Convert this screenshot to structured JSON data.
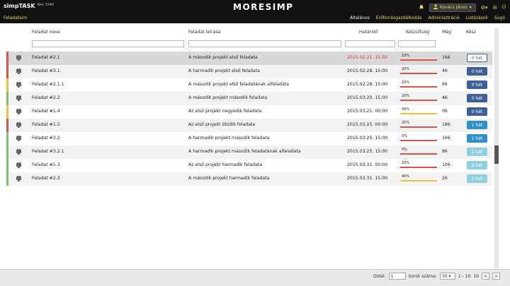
{
  "app": {
    "title": "simpTASK",
    "rev": "Rev 1046",
    "logo": "MORESIMP"
  },
  "topright": {
    "bell_icon": "bell-icon",
    "user": "Kovács János",
    "gear_icon": "gear-icon",
    "mail_icon": "mail-icon",
    "logout_icon": "logout-icon"
  },
  "nav": {
    "left": "Feladataim",
    "items": [
      {
        "label": "Általános",
        "active": true
      },
      {
        "label": "Erőforrásgazdálkodás",
        "active": false
      },
      {
        "label": "Adminisztráció",
        "active": false
      },
      {
        "label": "Listázások",
        "active": false
      },
      {
        "label": "Súgó",
        "active": false
      }
    ]
  },
  "columns": {
    "name": "Feladat neve",
    "desc": "Feladat leírása",
    "deadline": "Határidő",
    "progress": "Készültség",
    "remaining": "Még",
    "done": "Kész"
  },
  "rows": [
    {
      "name": "Feladat #2.1",
      "desc": "A második projekt első feladata",
      "date": "2015.02.21. 15:00",
      "overdue": true,
      "progress": "10%",
      "progress_val": 10,
      "remaining": "166",
      "done": "0 hét",
      "stripe": "#d9534f",
      "selected": true
    },
    {
      "name": "Feladat #3.1",
      "desc": "A harmadik projekt első feladata",
      "date": "2015.02.28. 15:00",
      "overdue": false,
      "progress": "20%",
      "progress_val": 20,
      "remaining": "46",
      "done": "0 hét",
      "stripe": "#d9534f"
    },
    {
      "name": "Feladat #2.1.1",
      "desc": "A második projekt első feladatának alfeladata",
      "date": "2015.02.28. 15:00",
      "overdue": false,
      "progress": "10%",
      "progress_val": 10,
      "remaining": "66",
      "done": "0 hét",
      "stripe": "#f0c13a"
    },
    {
      "name": "Feladat #2.2",
      "desc": "A második projekt második feladata",
      "date": "2015.03.20. 15:00",
      "overdue": false,
      "progress": "20%",
      "progress_val": 20,
      "remaining": "46",
      "done": "0 hét",
      "stripe": "#7cc070"
    },
    {
      "name": "Feladat #1.4",
      "desc": "Az első projekt negyedik feladata",
      "date": "2015.03.21. 00:00",
      "overdue": false,
      "progress": "50%",
      "progress_val": 50,
      "remaining": "06",
      "done": "0 hét",
      "stripe": "#f0c13a"
    },
    {
      "name": "Feladat #1.5",
      "desc": "Az első projekt ötödik feladata",
      "date": "2015.03.25. 00:00",
      "overdue": false,
      "progress": "25%",
      "progress_val": 25,
      "remaining": "186",
      "done": "1 hét",
      "stripe": "#d9534f"
    },
    {
      "name": "Feladat #3.2",
      "desc": "A harmadik projekt második feladata",
      "date": "2015.03.25. 15:00",
      "overdue": false,
      "progress": "0%",
      "progress_val": 0,
      "remaining": "166",
      "done": "1 hét",
      "stripe": "#7cc070"
    },
    {
      "name": "Feladat #3.2.1",
      "desc": "A harmadik projekt második feladatának alfeladata",
      "date": "2015.03.25. 15:00",
      "overdue": false,
      "progress": "0%",
      "progress_val": 0,
      "remaining": "86",
      "done": "2 hét",
      "stripe": "#7cc070"
    },
    {
      "name": "Feladat #1.3",
      "desc": "Az első projekt harmadik feladata",
      "date": "2015.03.31. 00:00",
      "overdue": false,
      "progress": "20%",
      "progress_val": 20,
      "remaining": "106",
      "done": "2 hét",
      "stripe": "#7cc070"
    },
    {
      "name": "Feladat #2.3",
      "desc": "A második projekt harmadik feladata",
      "date": "2015.03.31. 15:00",
      "overdue": false,
      "progress": "40%",
      "progress_val": 40,
      "remaining": "26",
      "done": "2 hét",
      "stripe": "#7cc070"
    }
  ],
  "footer": {
    "page_label": "Oldal:",
    "page_value": "1",
    "rows_label": "Sorok száma:",
    "rows_value": "30",
    "range": "1 - 10",
    "total": "10",
    "prev": "<",
    "next": ">"
  },
  "colors": {
    "overdue": "#d9302c",
    "done_0": "#3f5f97",
    "done_1": "#2f8fc8",
    "done_2": "#8ed0df",
    "bar_red": "#d9534f",
    "bar_yellow": "#f0c13a"
  }
}
